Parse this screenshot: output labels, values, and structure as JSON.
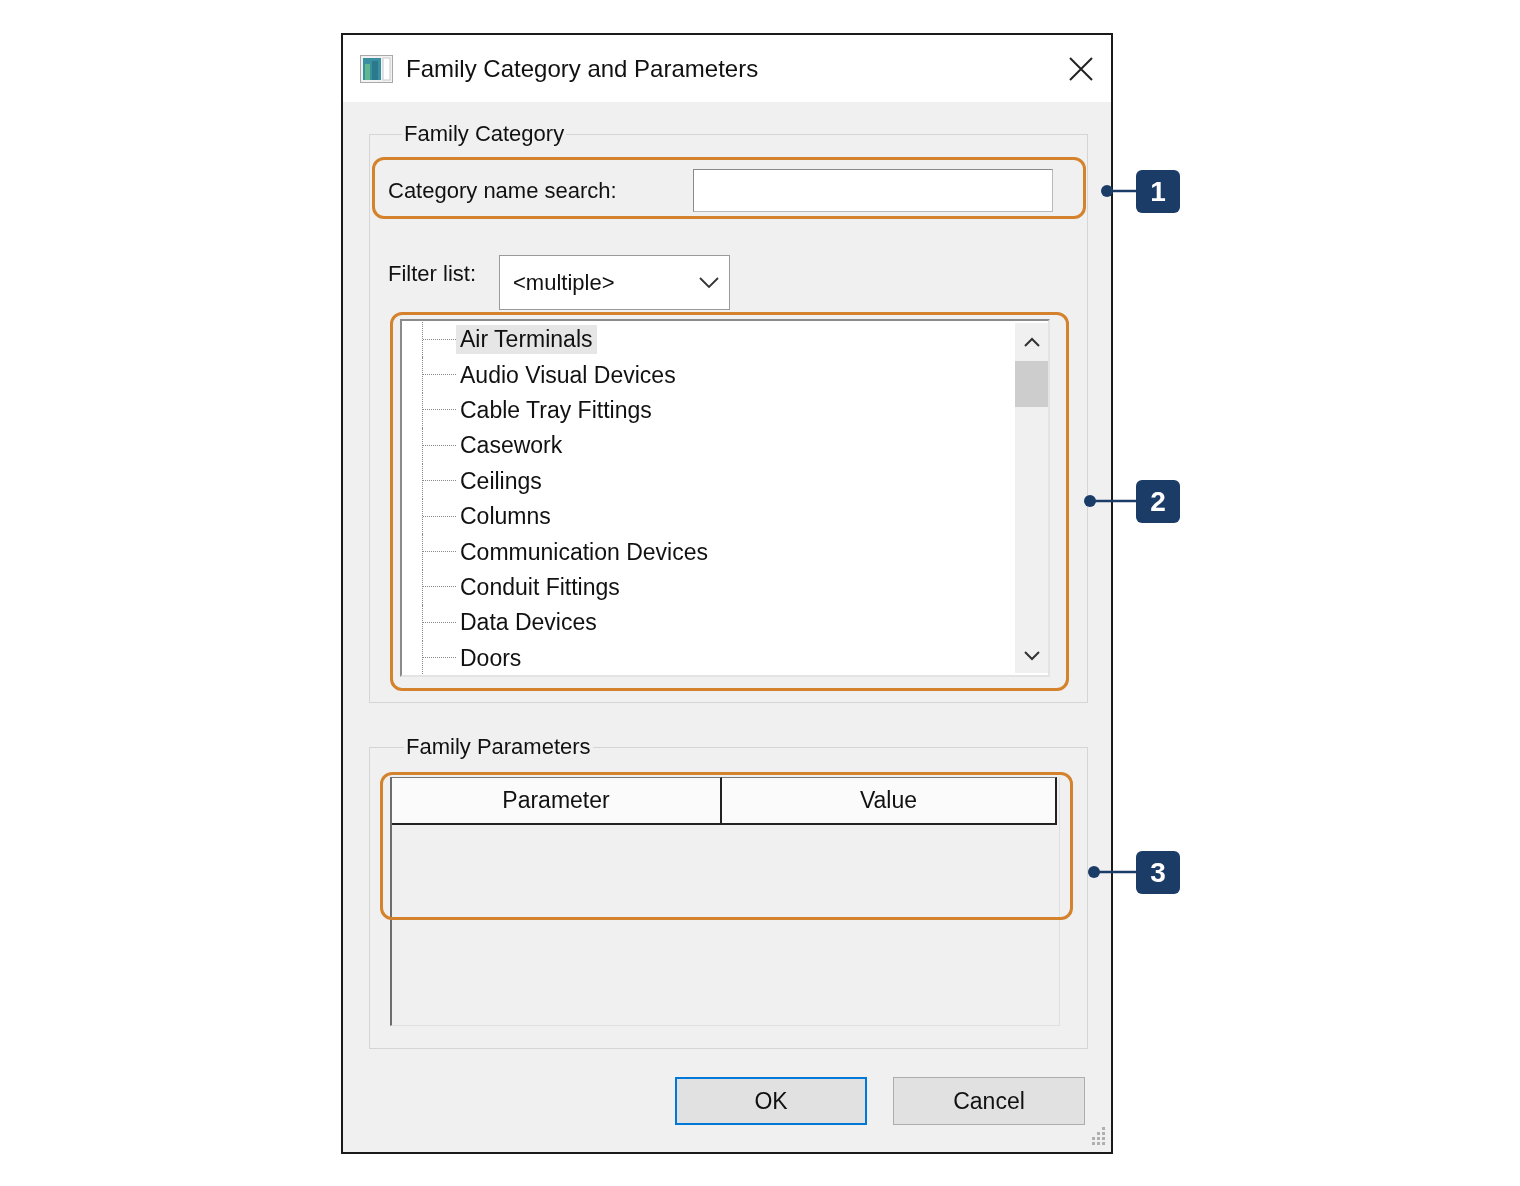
{
  "window": {
    "title": "Family Category and Parameters"
  },
  "family_category": {
    "legend": "Family Category",
    "search": {
      "label": "Category name search:"
    },
    "filter": {
      "label": "Filter list:",
      "value": "<multiple>"
    },
    "tree": {
      "items": [
        {
          "label": "Air Terminals",
          "selected": true
        },
        {
          "label": "Audio Visual Devices",
          "selected": false
        },
        {
          "label": "Cable Tray Fittings",
          "selected": false
        },
        {
          "label": "Casework",
          "selected": false
        },
        {
          "label": "Ceilings",
          "selected": false
        },
        {
          "label": "Columns",
          "selected": false
        },
        {
          "label": "Communication Devices",
          "selected": false
        },
        {
          "label": "Conduit Fittings",
          "selected": false
        },
        {
          "label": "Data Devices",
          "selected": false
        },
        {
          "label": "Doors",
          "selected": false
        }
      ]
    }
  },
  "family_parameters": {
    "legend": "Family Parameters",
    "table": {
      "columns": [
        "Parameter",
        "Value"
      ]
    }
  },
  "buttons": [
    {
      "label": "OK",
      "default": true
    },
    {
      "label": "Cancel",
      "default": false
    }
  ],
  "callouts": [
    {
      "number": "1"
    },
    {
      "number": "2"
    },
    {
      "number": "3"
    }
  ]
}
